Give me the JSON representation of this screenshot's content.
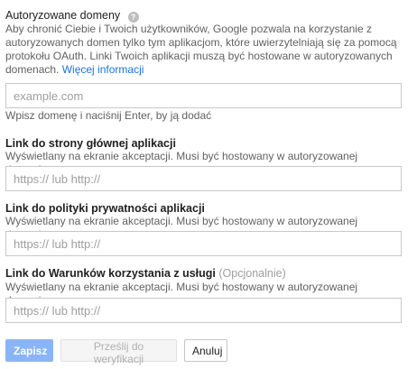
{
  "authorized_domains": {
    "title": "Autoryzowane domeny",
    "help_icon": "question-circle-icon",
    "description": "Aby chronić Ciebie i Twoich użytkowników, Google pozwala na korzystanie z autoryzowanych domen tylko tym aplikacjom, które uwierzytelniają się za pomocą protokołu OAuth. Linki Twoich aplikacji muszą być hostowane w autoryzowanych domenach.",
    "more_link": "Więcej informacji",
    "input_placeholder": "example.com",
    "hint": "Wpisz domenę i naciśnij Enter, by ją dodać"
  },
  "homepage_link": {
    "title": "Link do strony głównej aplikacji",
    "description": "Wyświetlany na ekranie akceptacji. Musi być hostowany w autoryzowanej domenie.",
    "input_placeholder": "https:// lub http://"
  },
  "privacy_link": {
    "title": "Link do polityki prywatności aplikacji",
    "description": "Wyświetlany na ekranie akceptacji. Musi być hostowany w autoryzowanej domenie.",
    "input_placeholder": "https:// lub http://"
  },
  "tos_link": {
    "title": "Link do Warunków korzystania z usługi",
    "optional": "(Opcjonalnie)",
    "description": "Wyświetlany na ekranie akceptacji. Musi być hostowany w autoryzowanej domenie.",
    "input_placeholder": "https:// lub http://"
  },
  "actions": {
    "save": "Zapisz",
    "submit_verification": "Prześlij do weryfikacji",
    "cancel": "Anuluj"
  },
  "colors": {
    "link": "#1a73e8",
    "primary_button": "#8ab4f8"
  }
}
